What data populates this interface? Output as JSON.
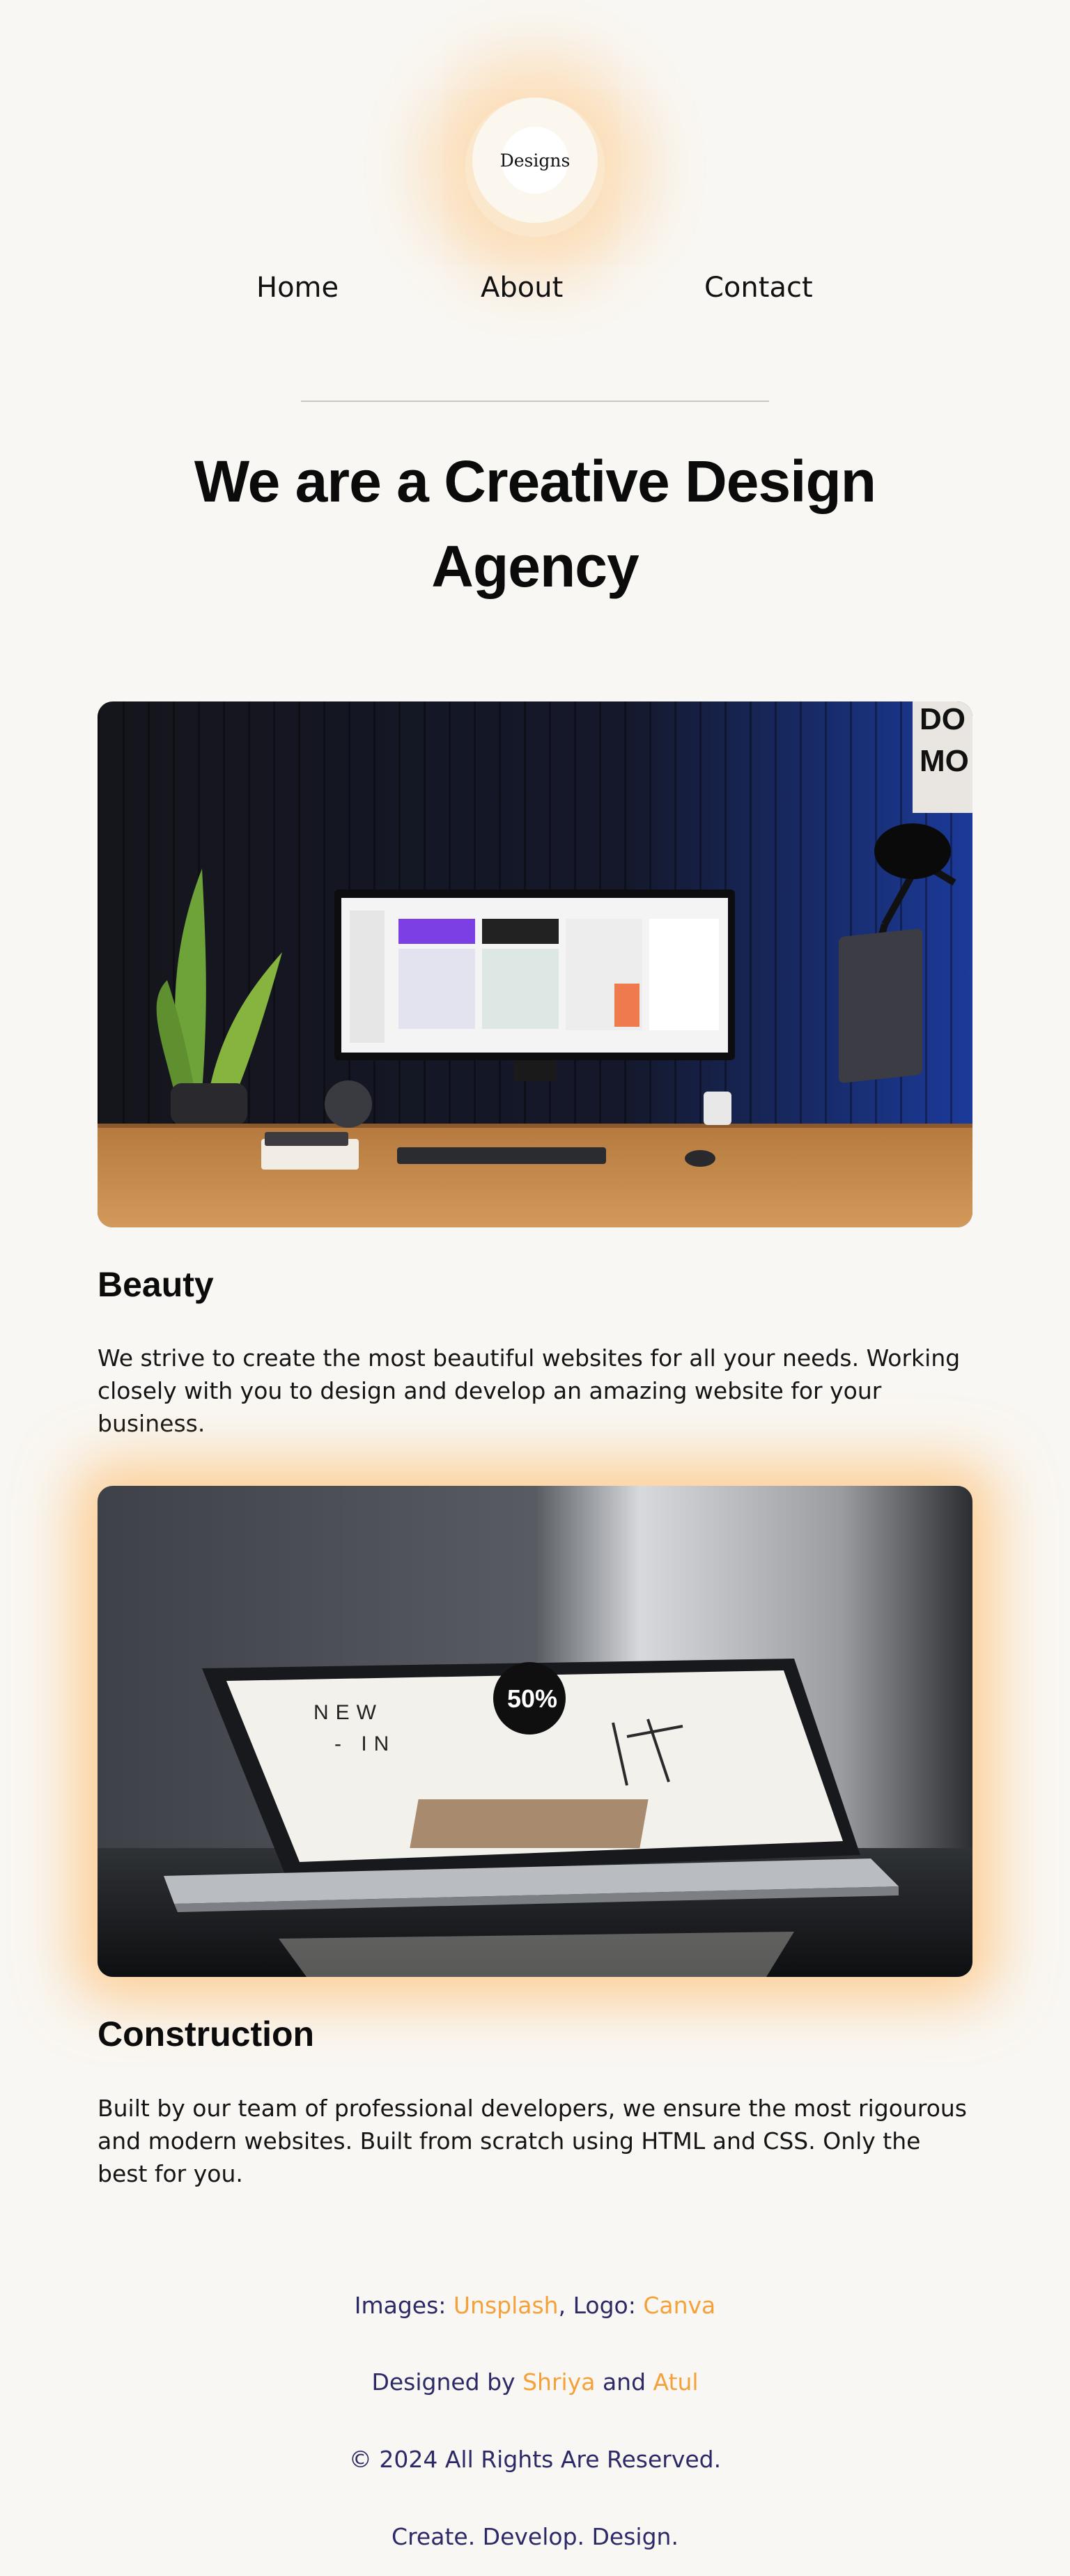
{
  "logo": {
    "text": "Designs"
  },
  "nav": {
    "items": [
      "Home",
      "About",
      "Contact"
    ]
  },
  "hero": {
    "line1": "We are a Creative Design",
    "line2": "Agency"
  },
  "sections": [
    {
      "title": "Beauty",
      "text": "We strive to create the most beautiful websites for all your needs. Working closely with you to design and develop an amazing website for your business."
    },
    {
      "title": "Construction",
      "text": "Built by our team of professional developers, we ensure the most rigourous and modern websites. Built from scratch using HTML and CSS. Only the best for you."
    }
  ],
  "footer": {
    "credits_prefix": "Images: ",
    "images_link": "Unsplash",
    "logo_prefix": ", Logo: ",
    "logo_link": "Canva",
    "designed_prefix": "Designed by ",
    "designer1": "Shriya",
    "and": " and ",
    "designer2": "Atul",
    "copyright": "© 2024 All Rights Are Reserved.",
    "tagline": "Create. Develop. Design."
  },
  "colors": {
    "background": "#f9f7f3",
    "accent": "#f5a13a",
    "footer_text": "#2c2a66",
    "glow": "#ffb050"
  },
  "icons": {
    "logo": "designs-logo-icon"
  }
}
